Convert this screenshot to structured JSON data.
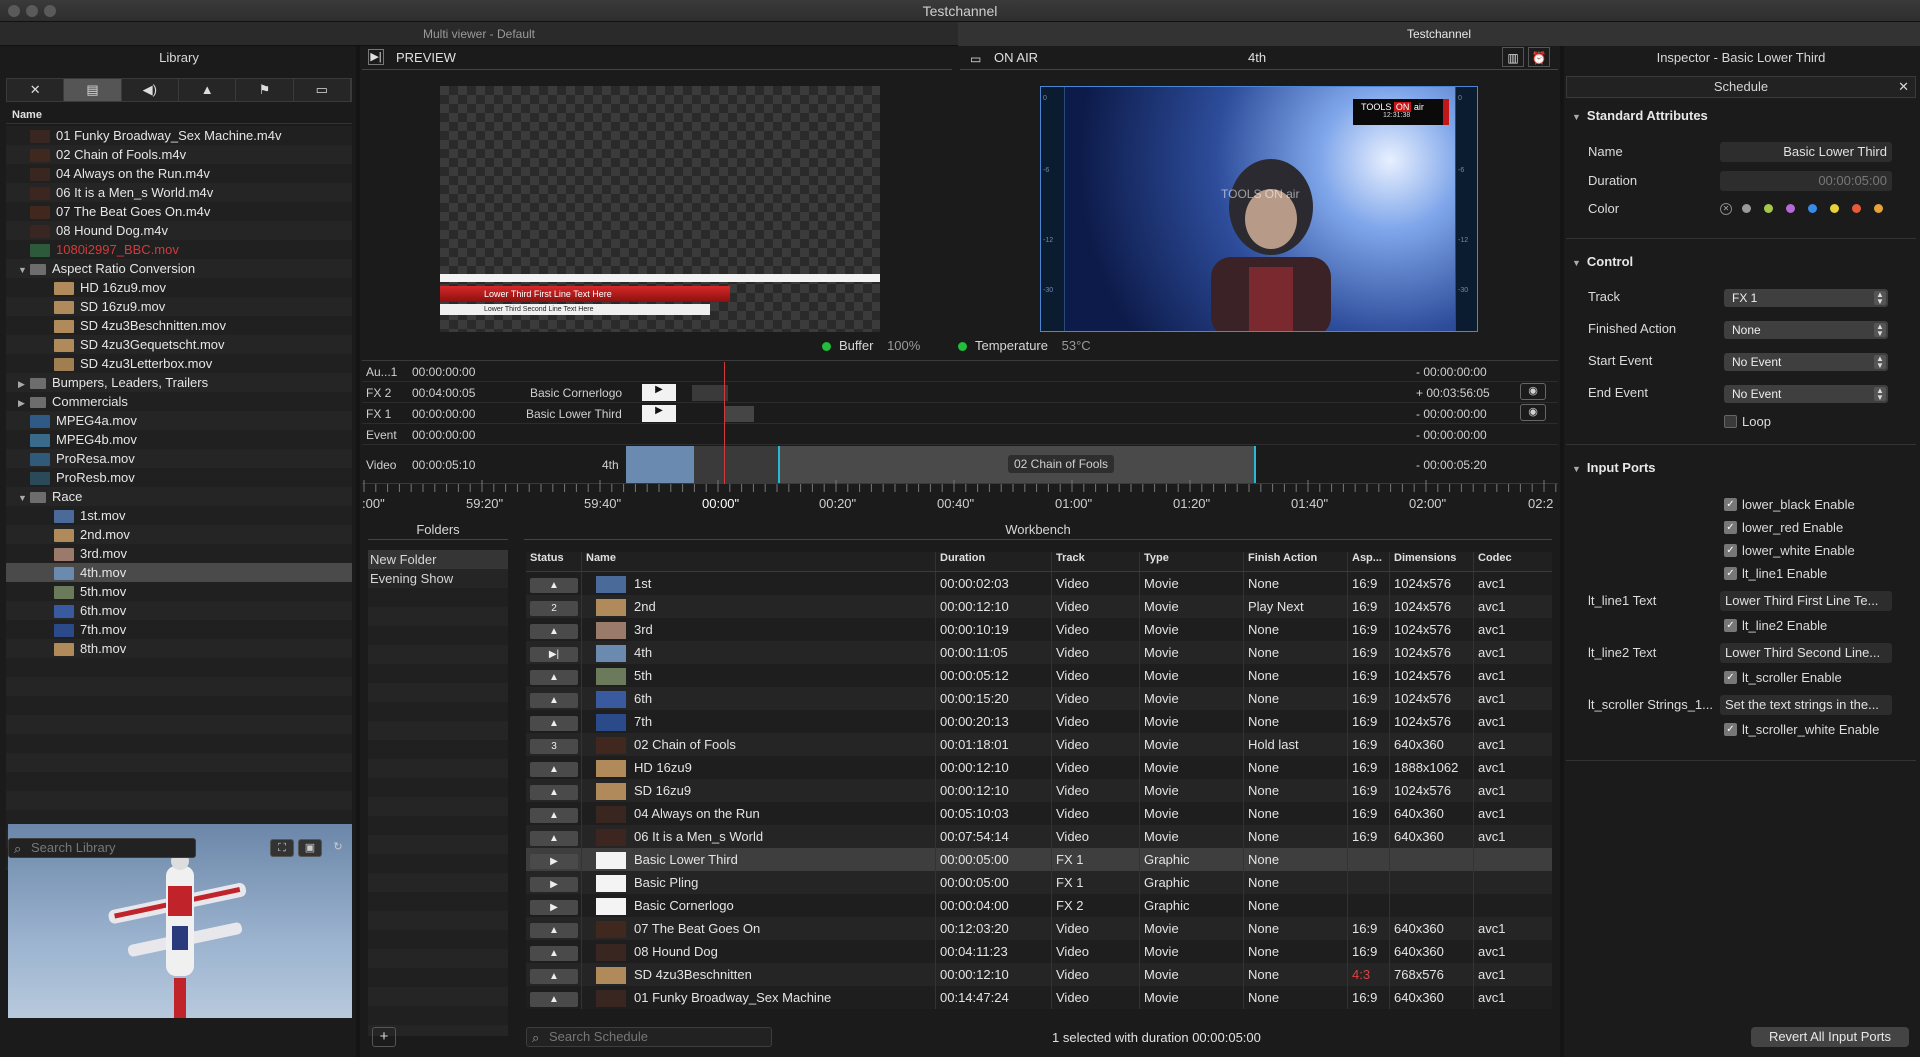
{
  "window": {
    "title": "Testchannel"
  },
  "tabs": [
    {
      "label": "Multi viewer - Default"
    },
    {
      "label": "Testchannel"
    }
  ],
  "library": {
    "title": "Library",
    "column": "Name",
    "items": [
      {
        "label": "01 Funky Broadway_Sex Machine.m4v",
        "indent": 0,
        "kind": "clip",
        "color": "#3a2620"
      },
      {
        "label": "02 Chain of Fools.m4v",
        "indent": 0,
        "kind": "clip",
        "color": "#40281f"
      },
      {
        "label": "04 Always on the Run.m4v",
        "indent": 0,
        "kind": "clip",
        "color": "#3a2620"
      },
      {
        "label": "06 It is a Men_s World.m4v",
        "indent": 0,
        "kind": "clip",
        "color": "#3d2520"
      },
      {
        "label": "07 The Beat Goes On.m4v",
        "indent": 0,
        "kind": "clip",
        "color": "#40281f"
      },
      {
        "label": "08 Hound Dog.m4v",
        "indent": 0,
        "kind": "clip",
        "color": "#3a2620"
      },
      {
        "label": "1080i2997_BBC.mov",
        "indent": 0,
        "kind": "clip",
        "color": "#2c5a3a",
        "red": true
      },
      {
        "label": "Aspect Ratio Conversion",
        "indent": 0,
        "kind": "folder",
        "open": true
      },
      {
        "label": "HD 16zu9.mov",
        "indent": 1,
        "kind": "clip",
        "color": "#b08a5a"
      },
      {
        "label": "SD 16zu9.mov",
        "indent": 1,
        "kind": "clip",
        "color": "#b08a5a"
      },
      {
        "label": "SD 4zu3Beschnitten.mov",
        "indent": 1,
        "kind": "clip",
        "color": "#b08a5a"
      },
      {
        "label": "SD 4zu3Gequetscht.mov",
        "indent": 1,
        "kind": "clip",
        "color": "#b08a5a"
      },
      {
        "label": "SD 4zu3Letterbox.mov",
        "indent": 1,
        "kind": "clip",
        "color": "#a07e52"
      },
      {
        "label": "Bumpers, Leaders, Trailers",
        "indent": 0,
        "kind": "folder",
        "open": false
      },
      {
        "label": "Commercials",
        "indent": 0,
        "kind": "folder",
        "open": false
      },
      {
        "label": "MPEG4a.mov",
        "indent": 0,
        "kind": "clip",
        "color": "#2f5a86"
      },
      {
        "label": "MPEG4b.mov",
        "indent": 0,
        "kind": "clip",
        "color": "#3a6a8a"
      },
      {
        "label": "ProResa.mov",
        "indent": 0,
        "kind": "clip",
        "color": "#2f5a7a"
      },
      {
        "label": "ProResb.mov",
        "indent": 0,
        "kind": "clip",
        "color": "#2a4a5a"
      },
      {
        "label": "Race",
        "indent": 0,
        "kind": "folder",
        "open": true
      },
      {
        "label": "1st.mov",
        "indent": 1,
        "kind": "clip",
        "color": "#4a6a9a"
      },
      {
        "label": "2nd.mov",
        "indent": 1,
        "kind": "clip",
        "color": "#b08a5a"
      },
      {
        "label": "3rd.mov",
        "indent": 1,
        "kind": "clip",
        "color": "#9a7a6a"
      },
      {
        "label": "4th.mov",
        "indent": 1,
        "kind": "clip",
        "color": "#6a8ab0",
        "selected": true
      },
      {
        "label": "5th.mov",
        "indent": 1,
        "kind": "clip",
        "color": "#6a7a5a"
      },
      {
        "label": "6th.mov",
        "indent": 1,
        "kind": "clip",
        "color": "#3a5aa0"
      },
      {
        "label": "7th.mov",
        "indent": 1,
        "kind": "clip",
        "color": "#2a4a8a"
      },
      {
        "label": "8th.mov",
        "indent": 1,
        "kind": "clip",
        "color": "#b08a5a"
      }
    ],
    "search_placeholder": "Search Library"
  },
  "preview": {
    "title": "PREVIEW",
    "lt_line1": "Lower Third First Line Text Here",
    "lt_line2": "Lower Third Second Line Text Here"
  },
  "onair": {
    "title": "ON AIR",
    "clip": "4th",
    "logo_clock": "12:31:38"
  },
  "status": {
    "buffer_label": "Buffer",
    "buffer_value": "100%",
    "temp_label": "Temperature",
    "temp_value": "53°C"
  },
  "timeline": {
    "rows": [
      {
        "track": "Au...1",
        "time": "00:00:00:00",
        "clip": "",
        "remaining": "- 00:00:00:00"
      },
      {
        "track": "FX 2",
        "time": "00:04:00:05",
        "clip": "Basic Cornerlogo",
        "remaining": "+ 00:03:56:05"
      },
      {
        "track": "FX 1",
        "time": "00:00:00:00",
        "clip": "Basic Lower Third",
        "remaining": "- 00:00:00:00"
      },
      {
        "track": "Event",
        "time": "00:00:00:00",
        "clip": "",
        "remaining": "- 00:00:00:00"
      },
      {
        "track": "Video",
        "time": "00:00:05:10",
        "clip": "4th",
        "remaining": "- 00:00:05:20"
      }
    ],
    "next_clip": "02 Chain of Fools",
    "ruler": [
      ":00\"",
      "59:20\"",
      "59:40\"",
      "00:00\"",
      "00:20\"",
      "00:40\"",
      "01:00\"",
      "01:20\"",
      "01:40\"",
      "02:00\"",
      "02:2"
    ]
  },
  "folders": {
    "title": "Folders",
    "items": [
      "New Folder",
      "Evening Show"
    ]
  },
  "workbench": {
    "title": "Workbench",
    "columns": [
      "Status",
      "Name",
      "Duration",
      "Track",
      "Type",
      "Finish Action",
      "Asp...",
      "Dimensions",
      "Codec"
    ],
    "rows": [
      {
        "status": "▲",
        "name": "1st",
        "duration": "00:00:02:03",
        "track": "Video",
        "type": "Movie",
        "finish": "None",
        "asp": "16:9",
        "dim": "1024x576",
        "codec": "avc1",
        "color": "#4a6a9a"
      },
      {
        "status": "2",
        "name": "2nd",
        "duration": "00:00:12:10",
        "track": "Video",
        "type": "Movie",
        "finish": "Play Next",
        "asp": "16:9",
        "dim": "1024x576",
        "codec": "avc1",
        "color": "#b08a5a"
      },
      {
        "status": "▲",
        "name": "3rd",
        "duration": "00:00:10:19",
        "track": "Video",
        "type": "Movie",
        "finish": "None",
        "asp": "16:9",
        "dim": "1024x576",
        "codec": "avc1",
        "color": "#9a7a6a"
      },
      {
        "status": "▶|",
        "name": "4th",
        "duration": "00:00:11:05",
        "track": "Video",
        "type": "Movie",
        "finish": "None",
        "asp": "16:9",
        "dim": "1024x576",
        "codec": "avc1",
        "color": "#6a8ab0"
      },
      {
        "status": "▲",
        "name": "5th",
        "duration": "00:00:05:12",
        "track": "Video",
        "type": "Movie",
        "finish": "None",
        "asp": "16:9",
        "dim": "1024x576",
        "codec": "avc1",
        "color": "#6a7a5a"
      },
      {
        "status": "▲",
        "name": "6th",
        "duration": "00:00:15:20",
        "track": "Video",
        "type": "Movie",
        "finish": "None",
        "asp": "16:9",
        "dim": "1024x576",
        "codec": "avc1",
        "color": "#3a5aa0"
      },
      {
        "status": "▲",
        "name": "7th",
        "duration": "00:00:20:13",
        "track": "Video",
        "type": "Movie",
        "finish": "None",
        "asp": "16:9",
        "dim": "1024x576",
        "codec": "avc1",
        "color": "#2a4a8a"
      },
      {
        "status": "3",
        "name": "02 Chain of Fools",
        "duration": "00:01:18:01",
        "track": "Video",
        "type": "Movie",
        "finish": "Hold last",
        "asp": "16:9",
        "dim": "640x360",
        "codec": "avc1",
        "color": "#40281f"
      },
      {
        "status": "▲",
        "name": "HD 16zu9",
        "duration": "00:00:12:10",
        "track": "Video",
        "type": "Movie",
        "finish": "None",
        "asp": "16:9",
        "dim": "1888x1062",
        "codec": "avc1",
        "color": "#b08a5a"
      },
      {
        "status": "▲",
        "name": "SD 16zu9",
        "duration": "00:00:12:10",
        "track": "Video",
        "type": "Movie",
        "finish": "None",
        "asp": "16:9",
        "dim": "1024x576",
        "codec": "avc1",
        "color": "#b08a5a"
      },
      {
        "status": "▲",
        "name": "04 Always on the Run",
        "duration": "00:05:10:03",
        "track": "Video",
        "type": "Movie",
        "finish": "None",
        "asp": "16:9",
        "dim": "640x360",
        "codec": "avc1",
        "color": "#3a2620"
      },
      {
        "status": "▲",
        "name": "06 It is a Men_s World",
        "duration": "00:07:54:14",
        "track": "Video",
        "type": "Movie",
        "finish": "None",
        "asp": "16:9",
        "dim": "640x360",
        "codec": "avc1",
        "color": "#3d2520"
      },
      {
        "status": "▶",
        "name": "Basic Lower Third",
        "duration": "00:00:05:00",
        "track": "FX 1",
        "type": "Graphic",
        "finish": "None",
        "asp": "",
        "dim": "",
        "codec": "",
        "color": "#f4f4f4",
        "selected": true
      },
      {
        "status": "▶",
        "name": "Basic Pling",
        "duration": "00:00:05:00",
        "track": "FX 1",
        "type": "Graphic",
        "finish": "None",
        "asp": "",
        "dim": "",
        "codec": "",
        "color": "#f4f4f4"
      },
      {
        "status": "▶",
        "name": "Basic Cornerlogo",
        "duration": "00:00:04:00",
        "track": "FX 2",
        "type": "Graphic",
        "finish": "None",
        "asp": "",
        "dim": "",
        "codec": "",
        "color": "#f4f4f4"
      },
      {
        "status": "▲",
        "name": "07 The Beat Goes On",
        "duration": "00:12:03:20",
        "track": "Video",
        "type": "Movie",
        "finish": "None",
        "asp": "16:9",
        "dim": "640x360",
        "codec": "avc1",
        "color": "#40281f"
      },
      {
        "status": "▲",
        "name": "08 Hound Dog",
        "duration": "00:04:11:23",
        "track": "Video",
        "type": "Movie",
        "finish": "None",
        "asp": "16:9",
        "dim": "640x360",
        "codec": "avc1",
        "color": "#3a2620"
      },
      {
        "status": "▲",
        "name": "SD 4zu3Beschnitten",
        "duration": "00:00:12:10",
        "track": "Video",
        "type": "Movie",
        "finish": "None",
        "asp": "4:3",
        "dim": "768x576",
        "codec": "avc1",
        "color": "#b08a5a",
        "asp_red": true
      },
      {
        "status": "▲",
        "name": "01 Funky Broadway_Sex Machine",
        "duration": "00:14:47:24",
        "track": "Video",
        "type": "Movie",
        "finish": "None",
        "asp": "16:9",
        "dim": "640x360",
        "codec": "avc1",
        "color": "#3a2620"
      }
    ],
    "search_placeholder": "Search Schedule",
    "selection_status": "1 selected with duration 00:00:05:00"
  },
  "inspector": {
    "title": "Inspector - Basic Lower Third",
    "tab": "Schedule",
    "standard_title": "Standard Attributes",
    "name_label": "Name",
    "name_value": "Basic Lower Third",
    "duration_label": "Duration",
    "duration_value": "00:00:05:00",
    "color_label": "Color",
    "colors": [
      "#9a9a9a",
      "#a6c84a",
      "#b56ad6",
      "#3a8ae8",
      "#e8d23a",
      "#e85a3a",
      "#e8a23a"
    ],
    "control_title": "Control",
    "track_label": "Track",
    "track_value": "FX 1",
    "finished_label": "Finished Action",
    "finished_value": "None",
    "start_label": "Start Event",
    "start_value": "No Event",
    "end_label": "End Event",
    "end_value": "No Event",
    "loop_label": "Loop",
    "ports_title": "Input Ports",
    "lower_black": "lower_black Enable",
    "lower_red": "lower_red Enable",
    "lower_white": "lower_white Enable",
    "lt_line1_enable": "lt_line1 Enable",
    "lt_line1_text_label": "lt_line1 Text",
    "lt_line1_text_value": "Lower Third First Line Te...",
    "lt_line2_enable": "lt_line2 Enable",
    "lt_line2_text_label": "lt_line2 Text",
    "lt_line2_text_value": "Lower Third Second Line...",
    "lt_scroller_enable": "lt_scroller Enable",
    "lt_scroller_label": "lt_scroller Strings_1...",
    "lt_scroller_value": "Set the text strings in the...",
    "lt_scroller_white": "lt_scroller_white Enable",
    "revert_label": "Revert All Input Ports"
  }
}
